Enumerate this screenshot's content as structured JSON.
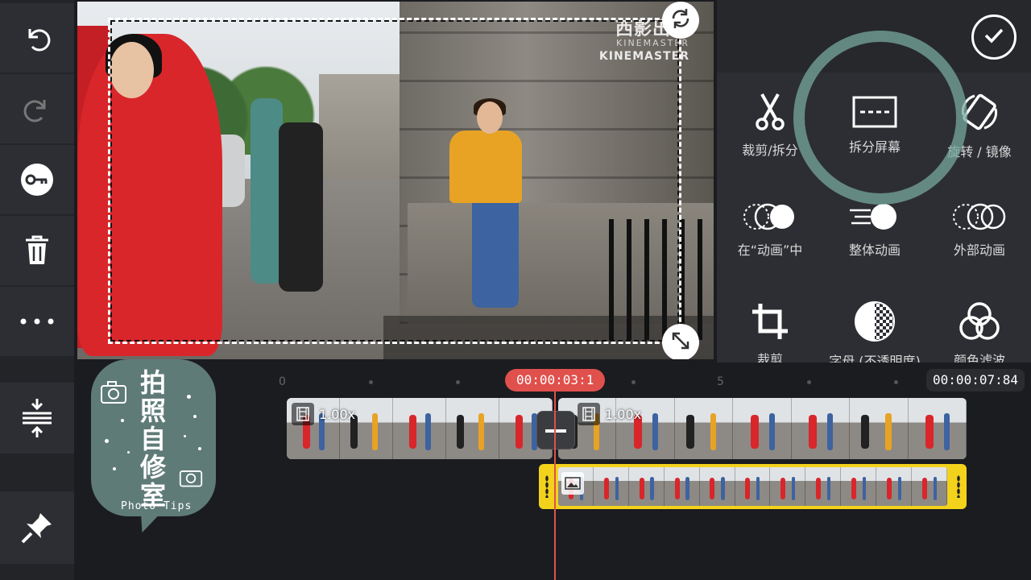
{
  "left_toolbar": {
    "items": [
      {
        "name": "undo-icon"
      },
      {
        "name": "redo-icon"
      },
      {
        "name": "keyframe-icon"
      },
      {
        "name": "trash-icon"
      },
      {
        "name": "more-icon"
      }
    ],
    "bottom_items": [
      {
        "name": "timeline-height-icon"
      },
      {
        "name": "pin-icon"
      }
    ]
  },
  "preview": {
    "watermark_main": "西影出品",
    "watermark_sub": "KINEMASTER",
    "watermark_brand": "KINEMASTER"
  },
  "panel": {
    "tools": [
      {
        "label": "裁剪/拆分",
        "icon": "scissors-icon"
      },
      {
        "label": "拆分屏幕",
        "icon": "split-screen-icon"
      },
      {
        "label": "旋转 / 镜像",
        "icon": "rotate-mirror-icon"
      },
      {
        "label": "在“动画”中",
        "icon": "in-animation-icon"
      },
      {
        "label": "整体动画",
        "icon": "overall-animation-icon"
      },
      {
        "label": "外部动画",
        "icon": "out-animation-icon"
      },
      {
        "label": "裁剪",
        "icon": "crop-icon"
      },
      {
        "label": "字母 (不透明度)",
        "icon": "alpha-opacity-icon"
      },
      {
        "label": "颜色滤波",
        "icon": "color-filter-icon"
      }
    ]
  },
  "timeline": {
    "ruler": [
      "0",
      "5"
    ],
    "current_time": "00:00:03:1",
    "total_time": "00:00:07:84",
    "clips": [
      {
        "speed": "1.00x"
      },
      {
        "speed": "1.00x"
      }
    ]
  },
  "sticker": {
    "title_chars": [
      "拍",
      "照",
      "自",
      "修",
      "室"
    ],
    "subtitle": "Photo Tips"
  },
  "colors": {
    "accent_red": "#e0504c",
    "layer_yellow": "#f2d21b",
    "ring_teal": "#77a89e"
  }
}
